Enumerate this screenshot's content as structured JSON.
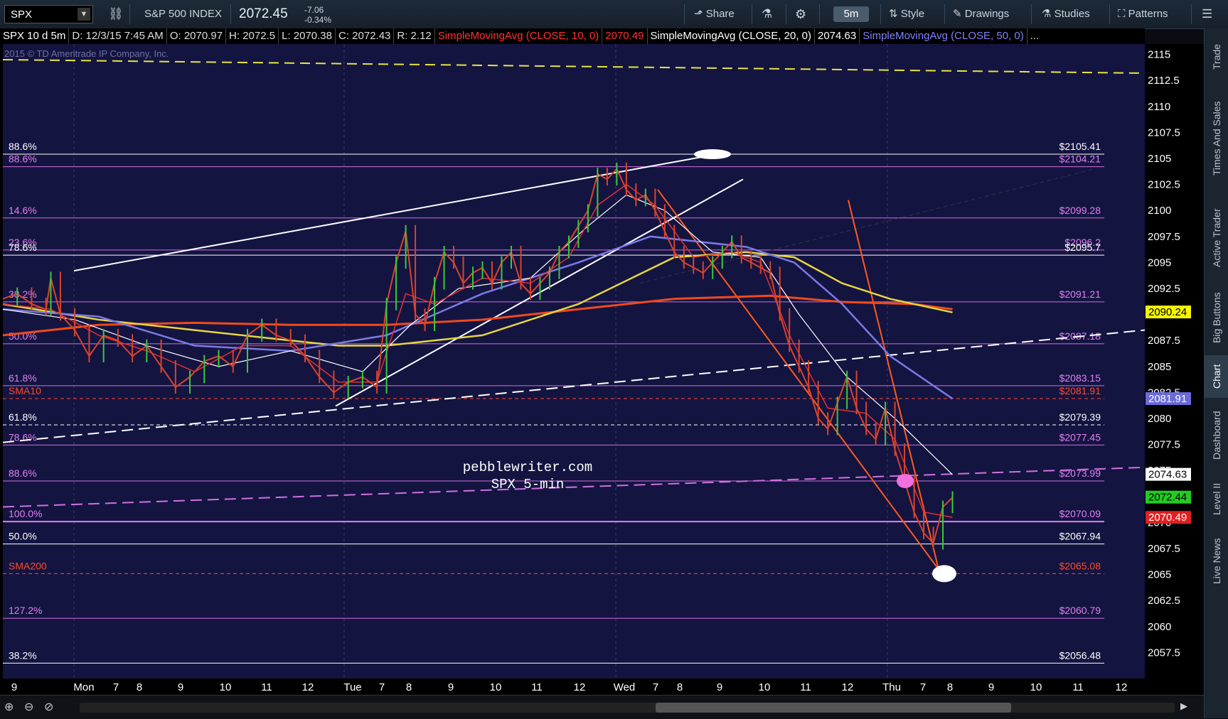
{
  "toolbar": {
    "symbol": "SPX",
    "index_name": "S&P 500 INDEX",
    "price": "2072.45",
    "change": "-7.06",
    "change_pct": "-0.34%",
    "share_label": "Share",
    "timeframe": "5m",
    "style_label": "Style",
    "drawings_label": "Drawings",
    "studies_label": "Studies",
    "patterns_label": "Patterns"
  },
  "infobar": {
    "title": "SPX 10 d 5m",
    "date": "D: 12/3/15 7:45 AM",
    "open": "O: 2070.97",
    "high": "H: 2072.5",
    "low": "L: 2070.38",
    "close": "C: 2072.43",
    "range": "R: 2.12",
    "sma10_label": "SimpleMovingAvg (CLOSE, 10, 0)",
    "sma10_value": "2070.49",
    "sma20_label": "SimpleMovingAvg (CLOSE, 20, 0)",
    "sma20_value": "2074.63",
    "sma50_label": "SimpleMovingAvg (CLOSE, 50, 0)",
    "more": "..."
  },
  "side_tabs": [
    "Trade",
    "Times And Sales",
    "Active Trader",
    "Big Buttons",
    "Chart",
    "Dashboard",
    "Level II",
    "Live News"
  ],
  "chart_data": {
    "type": "line",
    "title": "SPX 5-min",
    "watermark": "pebblewriter.com",
    "copyright": "2015 © TD Ameritrade IP Company, Inc.",
    "x_labels": [
      "9",
      "Mon",
      "7",
      "8",
      "9",
      "10",
      "11",
      "12",
      "Tue",
      "7",
      "8",
      "9",
      "10",
      "11",
      "12",
      "Wed",
      "7",
      "8",
      "9",
      "10",
      "11",
      "12",
      "Thu",
      "7",
      "8",
      "9",
      "10",
      "11",
      "12"
    ],
    "ylim": [
      2055,
      2116
    ],
    "y_ticks": [
      2057.5,
      2060,
      2062.5,
      2065,
      2067.5,
      2070,
      2072.5,
      2075,
      2077.5,
      2080,
      2082.5,
      2085,
      2087.5,
      2090,
      2092.5,
      2095,
      2097.5,
      2100,
      2102.5,
      2105,
      2107.5,
      2110,
      2112.5,
      2115
    ],
    "colors": {
      "background": "#141441",
      "price": "#d9432b",
      "sma10": "#e03030",
      "sma20": "#ffffff",
      "sma50": "#7a7ae6",
      "sma100": "#e6d640",
      "sma200": "#f04a1c",
      "fib": "#d070e0",
      "trend": "#ff5a1e"
    },
    "levels": [
      {
        "left": "88.6%",
        "right": "$2105.41",
        "value": 2105.41,
        "color": "#ffffff"
      },
      {
        "left": "88.6%",
        "right": "$2104.21",
        "value": 2104.21,
        "color": "#d070e0"
      },
      {
        "left": "14.6%",
        "right": "$2099.28",
        "value": 2099.28,
        "color": "#d070e0"
      },
      {
        "left": "23.6%",
        "right": "$2096.2",
        "value": 2096.2,
        "color": "#d070e0"
      },
      {
        "left": "78.6%",
        "right": "$2095.7",
        "value": 2095.7,
        "color": "#ffffff"
      },
      {
        "left": "38.2%",
        "right": "$2091.21",
        "value": 2091.21,
        "color": "#d070e0"
      },
      {
        "left": "50.0%",
        "right": "$2087.18",
        "value": 2087.18,
        "color": "#d070e0"
      },
      {
        "left": "61.8%",
        "right": "$2083.15",
        "value": 2083.15,
        "color": "#d070e0"
      },
      {
        "left": "SMA10",
        "right": "$2081.91",
        "value": 2081.91,
        "color": "#ff4a2a",
        "dashed": true
      },
      {
        "left": "61.8%",
        "right": "$2079.39",
        "value": 2079.39,
        "color": "#ffffff",
        "dashed": true
      },
      {
        "left": "78.6%",
        "right": "$2077.45",
        "value": 2077.45,
        "color": "#d070e0"
      },
      {
        "left": "88.6%",
        "right": "$2073.99",
        "value": 2073.99,
        "color": "#d070e0"
      },
      {
        "left": "100.0%",
        "right": "$2070.09",
        "value": 2070.09,
        "color": "#e080f0"
      },
      {
        "left": "50.0%",
        "right": "$2067.94",
        "value": 2067.94,
        "color": "#ffffff"
      },
      {
        "left": "SMA200",
        "right": "$2065.08",
        "value": 2065.08,
        "color": "#ff4a2a",
        "dashed": true
      },
      {
        "left": "127.2%",
        "right": "$2060.79",
        "value": 2060.79,
        "color": "#d070e0"
      },
      {
        "left": "38.2%",
        "right": "$2056.48",
        "value": 2056.48,
        "color": "#ffffff"
      }
    ],
    "price_tags": [
      {
        "label": "2090.24",
        "value": 2090.24,
        "bg": "#f5f500",
        "fg": "#000"
      },
      {
        "label": "2081.91",
        "value": 2081.91,
        "bg": "#6a6ad8",
        "fg": "#fff"
      },
      {
        "label": "2074.63",
        "value": 2074.63,
        "bg": "#ffffff",
        "fg": "#000"
      },
      {
        "label": "2072.44",
        "value": 2072.44,
        "bg": "#22cc22",
        "fg": "#000"
      },
      {
        "label": "2070.49",
        "value": 2070.49,
        "bg": "#e02020",
        "fg": "#fff"
      }
    ],
    "price_series": [
      [
        0,
        2091.5
      ],
      [
        3,
        2092
      ],
      [
        6,
        2091
      ],
      [
        9,
        2090.5
      ],
      [
        10,
        2093.5
      ],
      [
        12,
        2090
      ],
      [
        15,
        2088.5
      ],
      [
        18,
        2086
      ],
      [
        21,
        2088
      ],
      [
        24,
        2087.5
      ],
      [
        27,
        2086
      ],
      [
        30,
        2087
      ],
      [
        33,
        2085
      ],
      [
        36,
        2083
      ],
      [
        39,
        2084
      ],
      [
        42,
        2085.5
      ],
      [
        45,
        2086
      ],
      [
        48,
        2085
      ],
      [
        51,
        2088
      ],
      [
        54,
        2089
      ],
      [
        57,
        2088
      ],
      [
        60,
        2087.5
      ],
      [
        63,
        2086
      ],
      [
        66,
        2084
      ],
      [
        69,
        2082.5
      ],
      [
        72,
        2083.5
      ],
      [
        75,
        2084
      ],
      [
        78,
        2083
      ],
      [
        80,
        2091
      ],
      [
        82,
        2095
      ],
      [
        84,
        2098
      ],
      [
        86,
        2090
      ],
      [
        88,
        2089
      ],
      [
        90,
        2093
      ],
      [
        92,
        2096
      ],
      [
        94,
        2095
      ],
      [
        96,
        2093
      ],
      [
        98,
        2094
      ],
      [
        100,
        2094.5
      ],
      [
        102,
        2093
      ],
      [
        104,
        2095
      ],
      [
        106,
        2096
      ],
      [
        108,
        2093
      ],
      [
        110,
        2092
      ],
      [
        112,
        2093
      ],
      [
        114,
        2094
      ],
      [
        116,
        2096
      ],
      [
        118,
        2097
      ],
      [
        120,
        2098.5
      ],
      [
        122,
        2100
      ],
      [
        124,
        2103.5
      ],
      [
        126,
        2103
      ],
      [
        128,
        2104
      ],
      [
        130,
        2102
      ],
      [
        132,
        2101
      ],
      [
        134,
        2101.5
      ],
      [
        136,
        2100
      ],
      [
        138,
        2098
      ],
      [
        140,
        2096
      ],
      [
        142,
        2095
      ],
      [
        144,
        2094.5
      ],
      [
        146,
        2094
      ],
      [
        148,
        2095
      ],
      [
        150,
        2096
      ],
      [
        152,
        2097
      ],
      [
        154,
        2095.5
      ],
      [
        156,
        2095
      ],
      [
        158,
        2094.5
      ],
      [
        160,
        2094
      ],
      [
        162,
        2090
      ],
      [
        164,
        2087
      ],
      [
        166,
        2085
      ],
      [
        168,
        2083
      ],
      [
        170,
        2080
      ],
      [
        172,
        2079
      ],
      [
        174,
        2081.5
      ],
      [
        176,
        2084
      ],
      [
        178,
        2081
      ],
      [
        180,
        2079
      ],
      [
        182,
        2078
      ],
      [
        184,
        2081
      ],
      [
        186,
        2077
      ],
      [
        188,
        2074
      ],
      [
        190,
        2071
      ],
      [
        192,
        2069
      ],
      [
        194,
        2068
      ],
      [
        196,
        2071.5
      ],
      [
        198,
        2072.4
      ]
    ],
    "sma10_series": [
      [
        0,
        2091
      ],
      [
        10,
        2090.5
      ],
      [
        20,
        2088
      ],
      [
        30,
        2086.5
      ],
      [
        40,
        2084.5
      ],
      [
        50,
        2087
      ],
      [
        60,
        2087
      ],
      [
        70,
        2083.5
      ],
      [
        78,
        2083.5
      ],
      [
        84,
        2092
      ],
      [
        90,
        2091
      ],
      [
        100,
        2093.5
      ],
      [
        110,
        2093
      ],
      [
        118,
        2095.5
      ],
      [
        124,
        2100.5
      ],
      [
        130,
        2102.5
      ],
      [
        136,
        2100.5
      ],
      [
        144,
        2095.5
      ],
      [
        152,
        2096
      ],
      [
        158,
        2095
      ],
      [
        164,
        2088
      ],
      [
        172,
        2081
      ],
      [
        180,
        2080.5
      ],
      [
        186,
        2078
      ],
      [
        192,
        2071
      ],
      [
        198,
        2070.5
      ]
    ],
    "sma20_series": [
      [
        0,
        2090.5
      ],
      [
        15,
        2089.5
      ],
      [
        30,
        2087
      ],
      [
        45,
        2085
      ],
      [
        60,
        2086.5
      ],
      [
        75,
        2084.5
      ],
      [
        85,
        2089
      ],
      [
        95,
        2092.5
      ],
      [
        110,
        2093.5
      ],
      [
        122,
        2098.5
      ],
      [
        130,
        2101.5
      ],
      [
        138,
        2100
      ],
      [
        148,
        2096
      ],
      [
        158,
        2095.5
      ],
      [
        166,
        2090
      ],
      [
        176,
        2084
      ],
      [
        186,
        2080
      ],
      [
        198,
        2074.6
      ]
    ],
    "sma50_series": [
      [
        0,
        2090.5
      ],
      [
        20,
        2089.8
      ],
      [
        40,
        2087
      ],
      [
        60,
        2086.5
      ],
      [
        80,
        2088
      ],
      [
        100,
        2092
      ],
      [
        120,
        2095
      ],
      [
        135,
        2097.5
      ],
      [
        145,
        2097
      ],
      [
        155,
        2096.5
      ],
      [
        165,
        2095
      ],
      [
        175,
        2091
      ],
      [
        185,
        2086
      ],
      [
        198,
        2081.9
      ]
    ],
    "sma100_series": [
      [
        0,
        2091
      ],
      [
        20,
        2089.5
      ],
      [
        40,
        2088.5
      ],
      [
        60,
        2087.5
      ],
      [
        70,
        2087
      ],
      [
        80,
        2087
      ],
      [
        100,
        2088
      ],
      [
        120,
        2091
      ],
      [
        140,
        2095.5
      ],
      [
        155,
        2096
      ],
      [
        165,
        2095.5
      ],
      [
        175,
        2093
      ],
      [
        185,
        2091.5
      ],
      [
        198,
        2090.2
      ]
    ],
    "sma200_series": [
      [
        0,
        2088
      ],
      [
        20,
        2089
      ],
      [
        40,
        2089.2
      ],
      [
        60,
        2089
      ],
      [
        80,
        2089
      ],
      [
        100,
        2089.5
      ],
      [
        120,
        2090.5
      ],
      [
        140,
        2091.5
      ],
      [
        160,
        2091.8
      ],
      [
        175,
        2091.2
      ],
      [
        190,
        2091
      ],
      [
        198,
        2090.5
      ]
    ]
  }
}
